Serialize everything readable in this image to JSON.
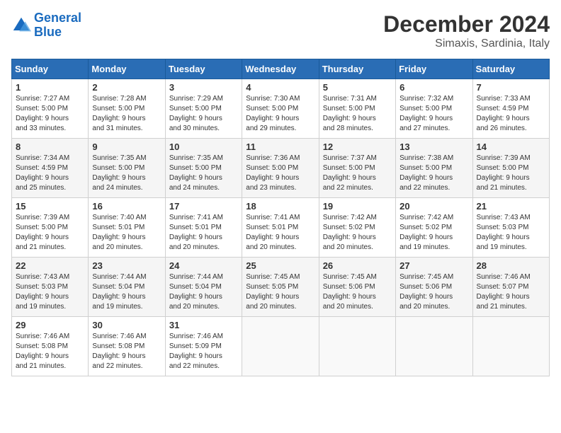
{
  "header": {
    "logo_line1": "General",
    "logo_line2": "Blue",
    "month": "December 2024",
    "location": "Simaxis, Sardinia, Italy"
  },
  "days_of_week": [
    "Sunday",
    "Monday",
    "Tuesday",
    "Wednesday",
    "Thursday",
    "Friday",
    "Saturday"
  ],
  "weeks": [
    [
      {
        "day": 1,
        "info": "Sunrise: 7:27 AM\nSunset: 5:00 PM\nDaylight: 9 hours\nand 33 minutes."
      },
      {
        "day": 2,
        "info": "Sunrise: 7:28 AM\nSunset: 5:00 PM\nDaylight: 9 hours\nand 31 minutes."
      },
      {
        "day": 3,
        "info": "Sunrise: 7:29 AM\nSunset: 5:00 PM\nDaylight: 9 hours\nand 30 minutes."
      },
      {
        "day": 4,
        "info": "Sunrise: 7:30 AM\nSunset: 5:00 PM\nDaylight: 9 hours\nand 29 minutes."
      },
      {
        "day": 5,
        "info": "Sunrise: 7:31 AM\nSunset: 5:00 PM\nDaylight: 9 hours\nand 28 minutes."
      },
      {
        "day": 6,
        "info": "Sunrise: 7:32 AM\nSunset: 5:00 PM\nDaylight: 9 hours\nand 27 minutes."
      },
      {
        "day": 7,
        "info": "Sunrise: 7:33 AM\nSunset: 4:59 PM\nDaylight: 9 hours\nand 26 minutes."
      }
    ],
    [
      {
        "day": 8,
        "info": "Sunrise: 7:34 AM\nSunset: 4:59 PM\nDaylight: 9 hours\nand 25 minutes."
      },
      {
        "day": 9,
        "info": "Sunrise: 7:35 AM\nSunset: 5:00 PM\nDaylight: 9 hours\nand 24 minutes."
      },
      {
        "day": 10,
        "info": "Sunrise: 7:35 AM\nSunset: 5:00 PM\nDaylight: 9 hours\nand 24 minutes."
      },
      {
        "day": 11,
        "info": "Sunrise: 7:36 AM\nSunset: 5:00 PM\nDaylight: 9 hours\nand 23 minutes."
      },
      {
        "day": 12,
        "info": "Sunrise: 7:37 AM\nSunset: 5:00 PM\nDaylight: 9 hours\nand 22 minutes."
      },
      {
        "day": 13,
        "info": "Sunrise: 7:38 AM\nSunset: 5:00 PM\nDaylight: 9 hours\nand 22 minutes."
      },
      {
        "day": 14,
        "info": "Sunrise: 7:39 AM\nSunset: 5:00 PM\nDaylight: 9 hours\nand 21 minutes."
      }
    ],
    [
      {
        "day": 15,
        "info": "Sunrise: 7:39 AM\nSunset: 5:00 PM\nDaylight: 9 hours\nand 21 minutes."
      },
      {
        "day": 16,
        "info": "Sunrise: 7:40 AM\nSunset: 5:01 PM\nDaylight: 9 hours\nand 20 minutes."
      },
      {
        "day": 17,
        "info": "Sunrise: 7:41 AM\nSunset: 5:01 PM\nDaylight: 9 hours\nand 20 minutes."
      },
      {
        "day": 18,
        "info": "Sunrise: 7:41 AM\nSunset: 5:01 PM\nDaylight: 9 hours\nand 20 minutes."
      },
      {
        "day": 19,
        "info": "Sunrise: 7:42 AM\nSunset: 5:02 PM\nDaylight: 9 hours\nand 20 minutes."
      },
      {
        "day": 20,
        "info": "Sunrise: 7:42 AM\nSunset: 5:02 PM\nDaylight: 9 hours\nand 19 minutes."
      },
      {
        "day": 21,
        "info": "Sunrise: 7:43 AM\nSunset: 5:03 PM\nDaylight: 9 hours\nand 19 minutes."
      }
    ],
    [
      {
        "day": 22,
        "info": "Sunrise: 7:43 AM\nSunset: 5:03 PM\nDaylight: 9 hours\nand 19 minutes."
      },
      {
        "day": 23,
        "info": "Sunrise: 7:44 AM\nSunset: 5:04 PM\nDaylight: 9 hours\nand 19 minutes."
      },
      {
        "day": 24,
        "info": "Sunrise: 7:44 AM\nSunset: 5:04 PM\nDaylight: 9 hours\nand 20 minutes."
      },
      {
        "day": 25,
        "info": "Sunrise: 7:45 AM\nSunset: 5:05 PM\nDaylight: 9 hours\nand 20 minutes."
      },
      {
        "day": 26,
        "info": "Sunrise: 7:45 AM\nSunset: 5:06 PM\nDaylight: 9 hours\nand 20 minutes."
      },
      {
        "day": 27,
        "info": "Sunrise: 7:45 AM\nSunset: 5:06 PM\nDaylight: 9 hours\nand 20 minutes."
      },
      {
        "day": 28,
        "info": "Sunrise: 7:46 AM\nSunset: 5:07 PM\nDaylight: 9 hours\nand 21 minutes."
      }
    ],
    [
      {
        "day": 29,
        "info": "Sunrise: 7:46 AM\nSunset: 5:08 PM\nDaylight: 9 hours\nand 21 minutes."
      },
      {
        "day": 30,
        "info": "Sunrise: 7:46 AM\nSunset: 5:08 PM\nDaylight: 9 hours\nand 22 minutes."
      },
      {
        "day": 31,
        "info": "Sunrise: 7:46 AM\nSunset: 5:09 PM\nDaylight: 9 hours\nand 22 minutes."
      },
      null,
      null,
      null,
      null
    ]
  ]
}
